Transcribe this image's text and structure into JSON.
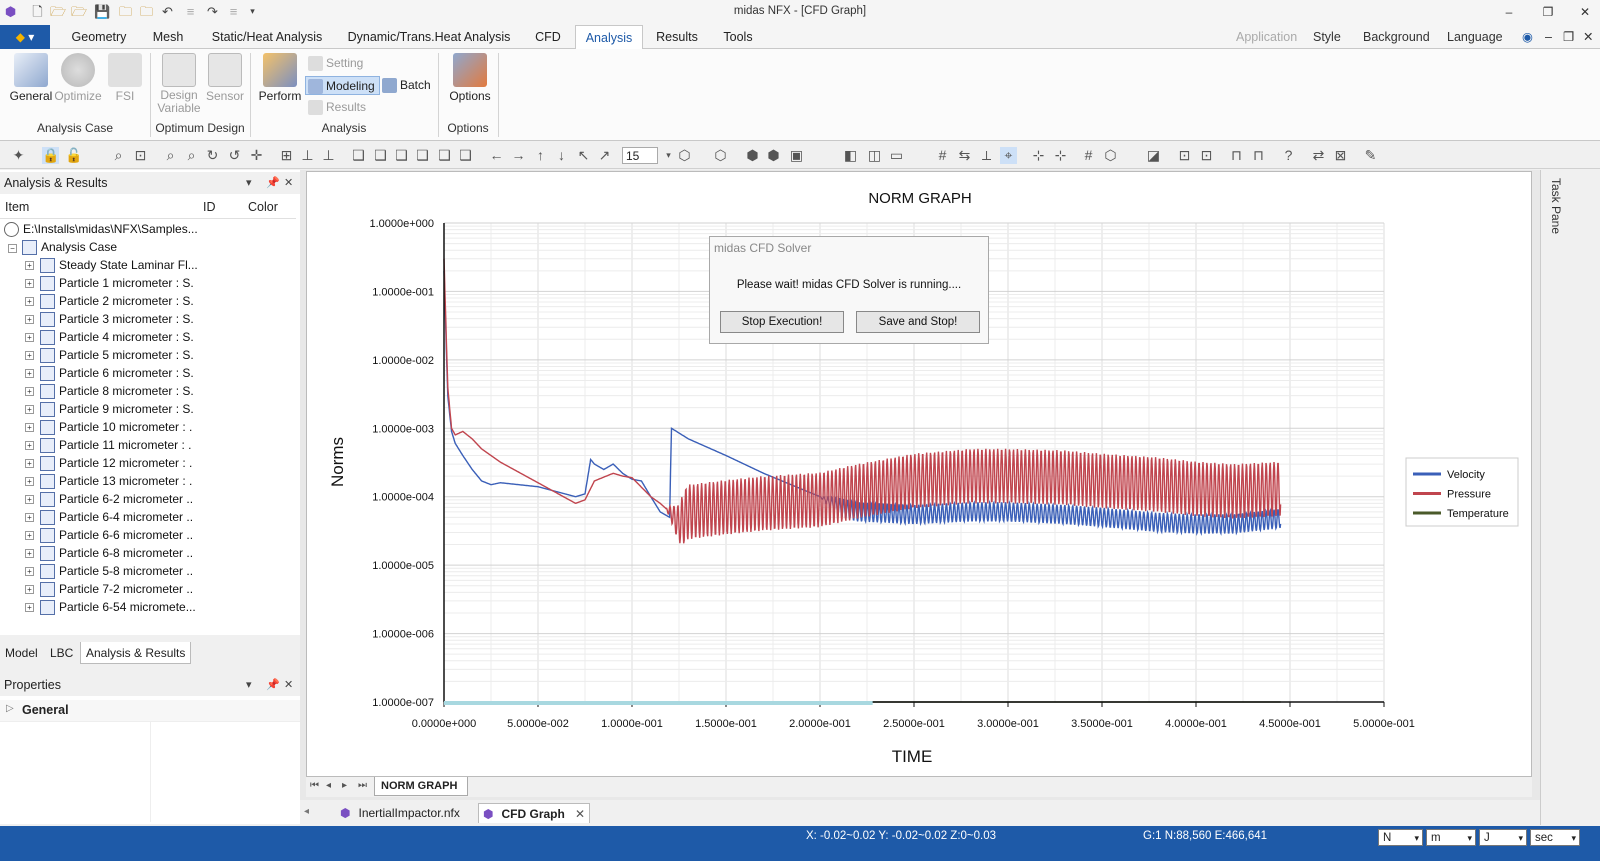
{
  "window": {
    "title": "midas NFX - [CFD Graph]",
    "controls": [
      "–",
      "❐",
      "✕"
    ]
  },
  "menu": {
    "app_button": "▾",
    "tabs": [
      "Geometry",
      "Mesh",
      "Static/Heat Analysis",
      "Dynamic/Trans.Heat Analysis",
      "CFD",
      "Analysis",
      "Results",
      "Tools"
    ],
    "active_tab": "Analysis",
    "right": {
      "application": "Application",
      "style": "Style",
      "background": "Background",
      "language": "Language"
    }
  },
  "ribbon": {
    "general": "General",
    "optimize": "Optimize",
    "fsi": "FSI",
    "design_variable_line1": "Design",
    "design_variable_line2": "Variable",
    "sensor": "Sensor",
    "perform": "Perform",
    "setting": "Setting",
    "modeling": "Modeling",
    "results": "Results",
    "batch": "Batch",
    "options": "Options",
    "groups": {
      "analysis_case": "Analysis Case",
      "optimum_design": "Optimum Design",
      "analysis": "Analysis",
      "options": "Options"
    }
  },
  "toolbar": {
    "view_number": "15"
  },
  "left_panel": {
    "title": "Analysis & Results",
    "columns": {
      "item": "Item",
      "id": "ID",
      "color": "Color"
    },
    "root": "E:\\Installs\\midas\\NFX\\Samples...",
    "analysis_case": "Analysis Case",
    "items": [
      "Steady State Laminar Fl...",
      "Particle 1 micrometer : S.",
      "Particle 2 micrometer : S.",
      "Particle 3 micrometer : S.",
      "Particle 4 micrometer : S.",
      "Particle 5 micrometer : S.",
      "Particle 6 micrometer : S.",
      "Particle 8 micrometer : S.",
      "Particle 9 micrometer : S.",
      "Particle 10 micrometer : .",
      "Particle 11 micrometer : .",
      "Particle 12 micrometer : .",
      "Particle 13 micrometer : .",
      "Particle 6-2 micrometer ..",
      "Particle 6-4 micrometer ..",
      "Particle 6-6 micrometer ..",
      "Particle 6-8 micrometer ..",
      "Particle 5-8 micrometer ..",
      "Particle 7-2 micrometer ..",
      "Particle 6-54 micromete..."
    ],
    "tabs": [
      "Model",
      "LBC",
      "Analysis & Results"
    ],
    "active_tab": "Analysis & Results"
  },
  "properties": {
    "title": "Properties",
    "section": "General"
  },
  "graph_sheet_tab": "NORM GRAPH",
  "document_tabs": [
    "InertialImpactor.nfx",
    "CFD Graph"
  ],
  "active_document": "CFD Graph",
  "task_pane": "Task Pane",
  "dialog": {
    "title": "midas CFD Solver",
    "message": "Please wait! midas CFD Solver is running....",
    "stop_button": "Stop Execution!",
    "save_stop_button": "Save and Stop!"
  },
  "status": {
    "coords": "X: -0.02~0.02 Y: -0.02~0.02 Z:0~0.03",
    "grid": "G:1 N:88,560 E:466,641",
    "unit_force": "N",
    "unit_length": "m",
    "unit_energy": "J",
    "unit_time": "sec"
  },
  "colors": {
    "accent": "#1e5aa8",
    "velocity": "#3a5fb8",
    "pressure": "#c0454e",
    "temperature": "#4a5a2a"
  },
  "chart_data": {
    "type": "line",
    "title": "NORM GRAPH",
    "xlabel": "TIME",
    "ylabel": "Norms",
    "xlim": [
      0,
      0.5
    ],
    "ylim": [
      1e-07,
      1
    ],
    "yscale": "log",
    "grid": true,
    "legend": "right",
    "x_ticks": [
      "0.0000e+000",
      "5.0000e-002",
      "1.0000e-001",
      "1.5000e-001",
      "2.0000e-001",
      "2.5000e-001",
      "3.0000e-001",
      "3.5000e-001",
      "4.0000e-001",
      "4.5000e-001",
      "5.0000e-001"
    ],
    "y_ticks": [
      "1.0000e+000",
      "1.0000e-001",
      "1.0000e-002",
      "1.0000e-003",
      "1.0000e-004",
      "1.0000e-005",
      "1.0000e-006",
      "1.0000e-007"
    ],
    "series": [
      {
        "name": "Velocity",
        "x": [
          0.0,
          0.002,
          0.004,
          0.006,
          0.01,
          0.015,
          0.02,
          0.025,
          0.03,
          0.05,
          0.07,
          0.075,
          0.078,
          0.08,
          0.085,
          0.09,
          0.095,
          0.1,
          0.105,
          0.11,
          0.115,
          0.12,
          0.121,
          0.13,
          0.15,
          0.17,
          0.19,
          0.2,
          0.21,
          0.22,
          0.25,
          0.28,
          0.3,
          0.33,
          0.35,
          0.38,
          0.4,
          0.42,
          0.445
        ],
        "y": [
          0.2,
          0.003,
          0.0009,
          0.0006,
          0.0004,
          0.00025,
          0.00017,
          0.00015,
          0.00016,
          0.00014,
          0.0001,
          0.00011,
          0.00035,
          0.0003,
          0.00025,
          0.0003,
          0.00022,
          0.00018,
          0.00017,
          0.0001,
          6e-05,
          5e-05,
          0.001,
          0.0007,
          0.0004,
          0.00022,
          0.00013,
          0.0001,
          7e-05,
          6e-05,
          5.5e-05,
          6e-05,
          6e-05,
          5.5e-05,
          5e-05,
          4.2e-05,
          4e-05,
          4e-05,
          4.8e-05
        ],
        "color": "#3a5fb8",
        "oscillation": {
          "from": 0.2,
          "to": 0.445,
          "amplitude_decades": 0.14
        }
      },
      {
        "name": "Pressure",
        "x": [
          0.0,
          0.002,
          0.004,
          0.006,
          0.01,
          0.015,
          0.02,
          0.03,
          0.05,
          0.07,
          0.075,
          0.08,
          0.09,
          0.095,
          0.1,
          0.11,
          0.115,
          0.12,
          0.125,
          0.13,
          0.15,
          0.17,
          0.2,
          0.22,
          0.25,
          0.28,
          0.3,
          0.33,
          0.35,
          0.38,
          0.4,
          0.42,
          0.445
        ],
        "y": [
          0.3,
          0.004,
          0.001,
          0.0008,
          0.0009,
          0.0007,
          0.0005,
          0.00032,
          0.00016,
          8e-05,
          9e-05,
          0.00017,
          0.00022,
          0.0002,
          0.00019,
          0.0001,
          8e-05,
          6e-05,
          4e-05,
          6e-05,
          7e-05,
          8e-05,
          9e-05,
          0.00012,
          0.00017,
          0.0002,
          0.0002,
          0.00019,
          0.00017,
          0.00015,
          0.00013,
          0.00012,
          0.00013
        ],
        "color": "#c0454e",
        "oscillation": {
          "from": 0.118,
          "to": 0.445,
          "amplitude_decades": 0.4
        }
      },
      {
        "name": "Temperature",
        "x": [
          0.0,
          0.445
        ],
        "y": [
          1e-07,
          1e-07
        ],
        "color": "#4a5a2a"
      }
    ]
  }
}
